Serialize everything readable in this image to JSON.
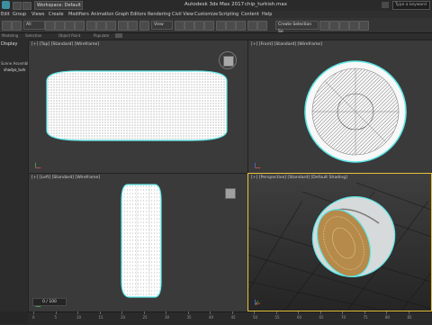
{
  "titlebar": {
    "app_title": "Autodesk 3ds Max 2017",
    "file_title": "chip_turkish.max",
    "workspace": "Workspace: Default",
    "search_placeholder": "Type a keyword"
  },
  "menu": [
    "Edit",
    "Group",
    "Views",
    "Create",
    "Modifiers",
    "Animation",
    "Graph Editors",
    "Rendering",
    "Civil View",
    "Customize",
    "Scripting",
    "Content",
    "Help"
  ],
  "toolbar": {
    "filter_value": "All",
    "view_value": "View",
    "selection_set": "Create Selection Se"
  },
  "ribbon_labels": [
    "Modeling",
    "Selection",
    "Object Paint",
    "Populate"
  ],
  "left_panel": {
    "tab": "Display",
    "scene_items": [
      "Scene Assembly",
      "shadyo_turk"
    ]
  },
  "viewports": {
    "top": "[+] [Top] [Standard] [Wireframe]",
    "front": "[+] [Front] [Standard] [Wireframe]",
    "left": "[+] [Left] [Standard] [Wireframe]",
    "perspective": "[+] [Perspective] [Standard] [Default Shading]"
  },
  "timeline": {
    "frame_counter": "0 / 100",
    "ticks": [
      "0",
      "5",
      "10",
      "15",
      "20",
      "25",
      "30",
      "35",
      "40",
      "45",
      "50",
      "55",
      "60",
      "65",
      "70",
      "75",
      "80",
      "85"
    ]
  },
  "colors": {
    "selection_outline": "#5ee6e6",
    "active_viewport_border": "#e7c23a",
    "coin_gold": "#b58a4a"
  }
}
